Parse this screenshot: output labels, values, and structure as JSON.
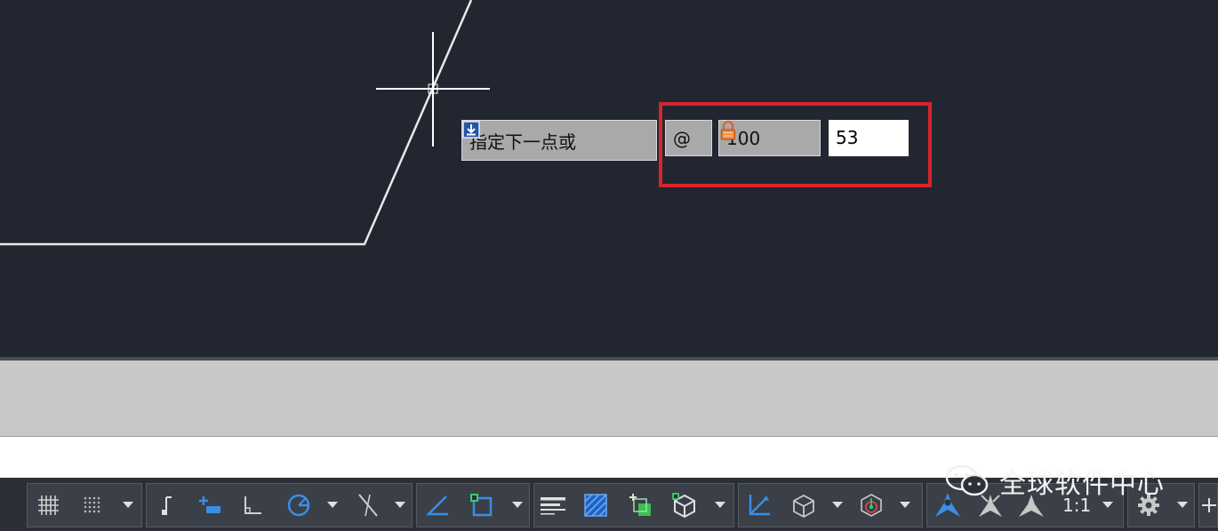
{
  "dynamic_input": {
    "prompt": "指定下一点或",
    "relative_symbol": "@",
    "length_value": "100",
    "angle_value": "53"
  },
  "status_bar": {
    "annotation_scale": "1:1"
  },
  "watermark": "全球软件中心",
  "colors": {
    "canvas": "#212631",
    "highlight": "#d8242b",
    "status_bar": "#2b2f38",
    "icon_blue": "#3a8ee6"
  },
  "icons": [
    "grid-icon",
    "snap-grid-icon",
    "ortho-icon",
    "infer-constraints-icon",
    "isodraft-icon",
    "polar-tracking-icon",
    "object-snap-tracking-icon",
    "2d-object-snap-icon",
    "lineweight-icon",
    "transparency-icon",
    "selection-cycling-icon",
    "3d-object-snap-icon",
    "dynamic-ucs-icon",
    "selection-filter-icon",
    "gizmo-icon",
    "annotation-visibility-icon",
    "auto-scale-icon",
    "annotation-monitor-icon",
    "workspace-gear-icon"
  ]
}
